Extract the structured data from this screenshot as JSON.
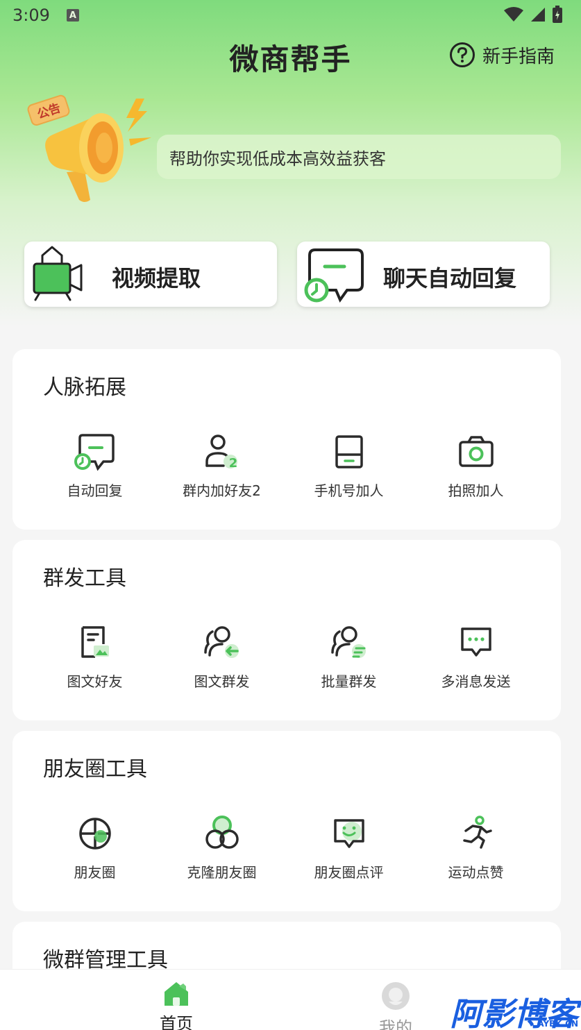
{
  "status_bar": {
    "time": "3:09",
    "notification_letter": "A"
  },
  "header": {
    "title": "微商帮手",
    "guide_label": "新手指南"
  },
  "announcement": {
    "badge": "公告",
    "text": "帮助你实现低成本高效益获客"
  },
  "quick_actions": [
    {
      "label": "视频提取",
      "icon": "video-extract-icon"
    },
    {
      "label": "聊天自动回复",
      "icon": "chat-auto-reply-icon"
    }
  ],
  "sections": [
    {
      "title": "人脉拓展",
      "tools": [
        {
          "label": "自动回复",
          "icon": "auto-reply-icon"
        },
        {
          "label": "群内加好友2",
          "icon": "group-add-friend-icon"
        },
        {
          "label": "手机号加人",
          "icon": "phone-add-icon"
        },
        {
          "label": "拍照加人",
          "icon": "camera-add-icon"
        }
      ]
    },
    {
      "title": "群发工具",
      "tools": [
        {
          "label": "图文好友",
          "icon": "image-text-friend-icon"
        },
        {
          "label": "图文群发",
          "icon": "image-text-mass-icon"
        },
        {
          "label": "批量群发",
          "icon": "batch-mass-icon"
        },
        {
          "label": "多消息发送",
          "icon": "multi-message-icon"
        }
      ]
    },
    {
      "title": "朋友圈工具",
      "tools": [
        {
          "label": "朋友圈",
          "icon": "moments-icon"
        },
        {
          "label": "克隆朋友圈",
          "icon": "clone-moments-icon"
        },
        {
          "label": "朋友圈点评",
          "icon": "moments-comment-icon"
        },
        {
          "label": "运动点赞",
          "icon": "sport-like-icon"
        }
      ]
    },
    {
      "title": "微群管理工具"
    }
  ],
  "tabbar": {
    "home_label": "首页",
    "mine_label": "我的"
  },
  "watermark": {
    "main": "阿影博客",
    "sub": "AYBK.CN"
  },
  "colors": {
    "accent": "#4cc15a",
    "icon_dark": "#2b2b2b",
    "watermark": "#1a5fe0"
  }
}
